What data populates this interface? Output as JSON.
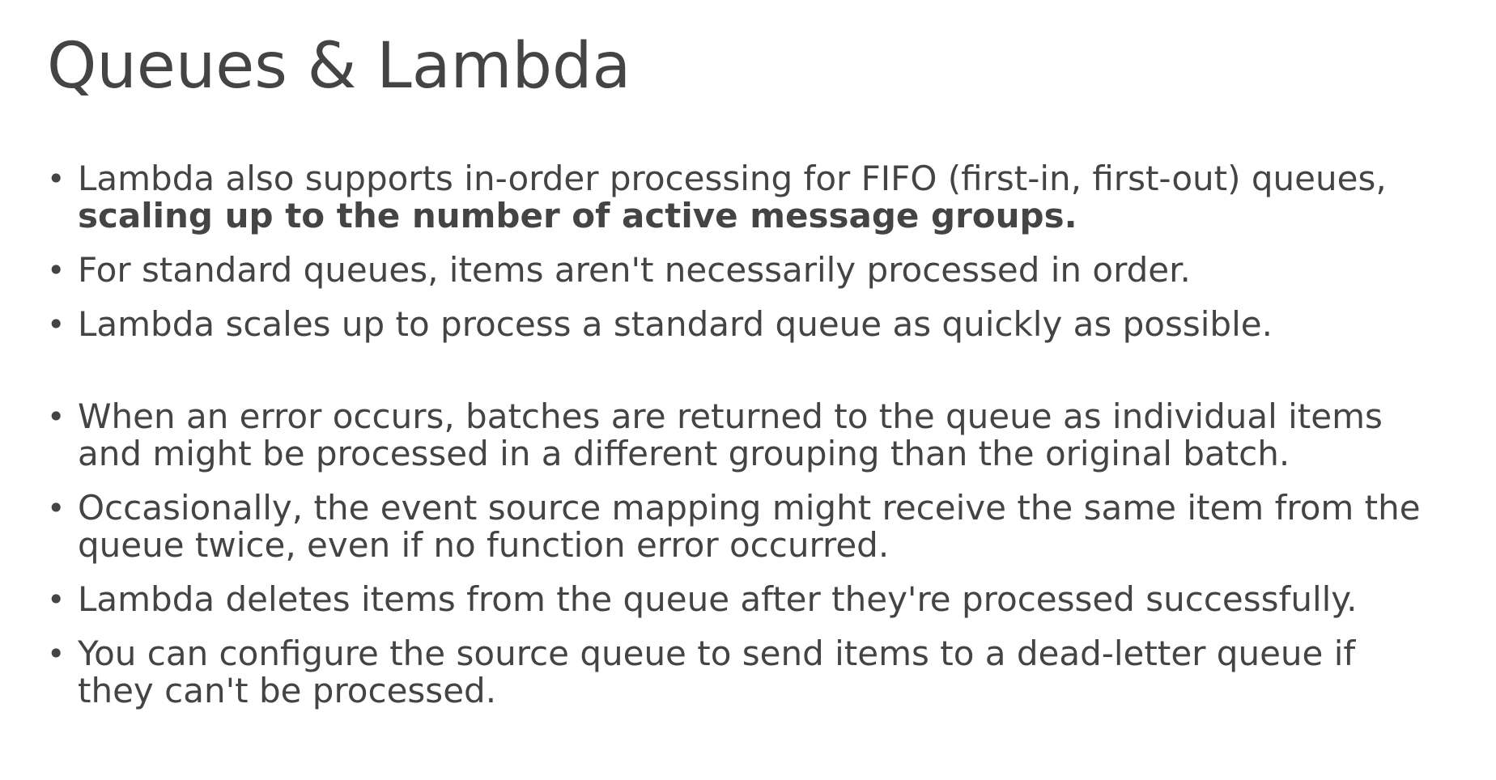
{
  "slide": {
    "title": "Queues & Lambda",
    "bullets": [
      {
        "line1": "Lambda also supports in-order processing for FIFO (first-in, first-out) queues,",
        "line2_bold": "scaling up to the number of active message groups."
      },
      {
        "line1": "For standard queues, items aren't necessarily processed in order."
      },
      {
        "line1": "Lambda scales up to process a standard queue as quickly as possible."
      },
      {
        "line1": "When an error occurs, batches are returned to the queue as individual items",
        "line2": "and might be processed in a different grouping than the original batch."
      },
      {
        "line1": "Occasionally, the event source mapping might receive the same item from the",
        "line2": "queue twice, even if no function error occurred."
      },
      {
        "line1": "Lambda deletes items from the queue after they're processed successfully."
      },
      {
        "line1": "You can configure the source queue to send items to a dead-letter queue if",
        "line2": "they can't be processed."
      }
    ]
  }
}
